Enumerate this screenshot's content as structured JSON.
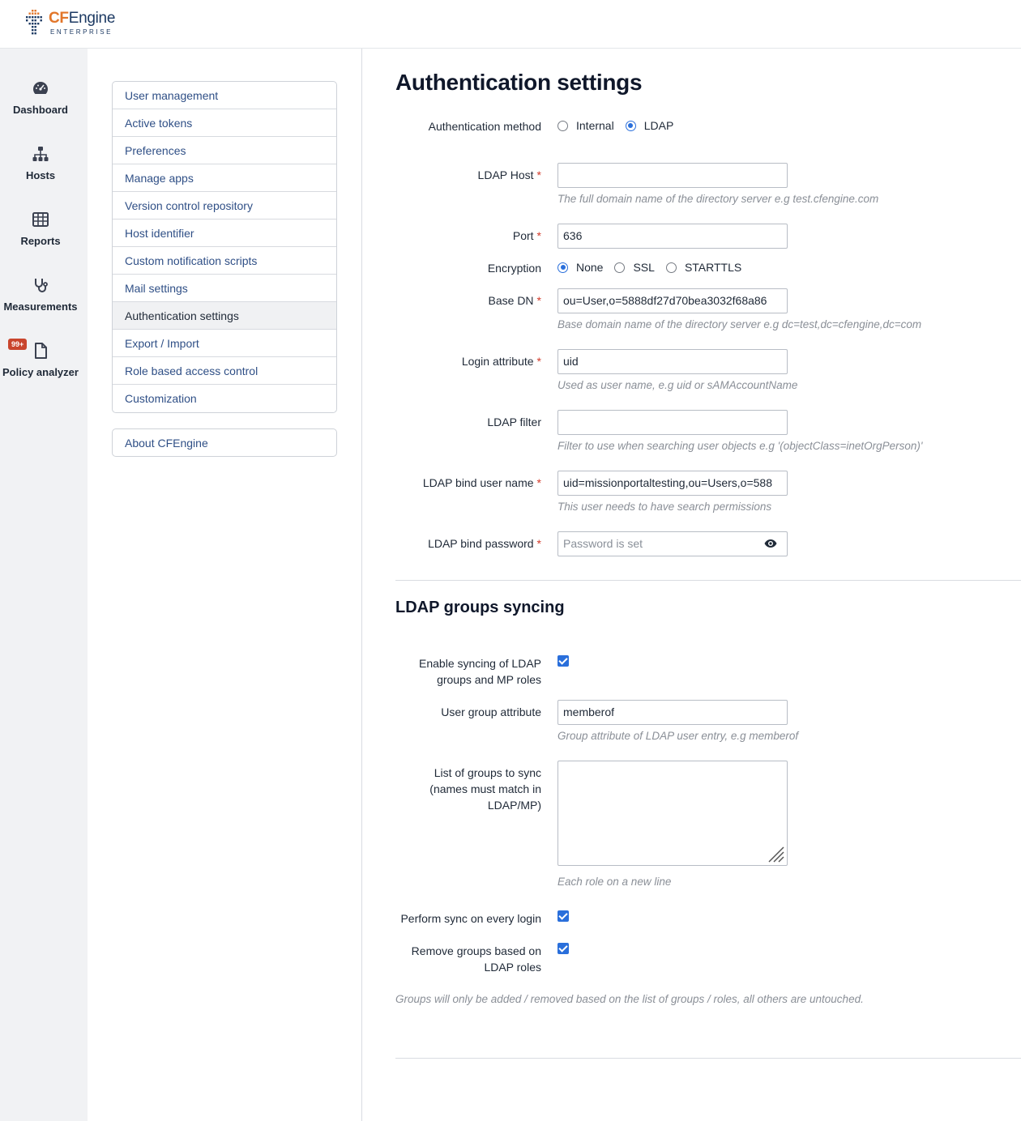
{
  "brand": {
    "cf": "CF",
    "engine": "Engine",
    "edition": "ENTERPRISE"
  },
  "nav": {
    "dashboard": "Dashboard",
    "hosts": "Hosts",
    "reports": "Reports",
    "measurements": "Measurements",
    "policy_analyzer": "Policy analyzer",
    "policy_badge": "99+"
  },
  "settings_menu": [
    "User management",
    "Active tokens",
    "Preferences",
    "Manage apps",
    "Version control repository",
    "Host identifier",
    "Custom notification scripts",
    "Mail settings",
    "Authentication settings",
    "Export / Import",
    "Role based access control",
    "Customization"
  ],
  "about": "About CFEngine",
  "page": {
    "title": "Authentication settings",
    "auth_method": {
      "label": "Authentication method",
      "internal": "Internal",
      "ldap": "LDAP",
      "selected": "LDAP"
    },
    "ldap_host": {
      "label": "LDAP Host",
      "value": "",
      "hint": "The full domain name of the directory server e.g test.cfengine.com"
    },
    "port": {
      "label": "Port",
      "value": "636"
    },
    "encryption": {
      "label": "Encryption",
      "none": "None",
      "ssl": "SSL",
      "starttls": "STARTTLS",
      "selected": "None"
    },
    "base_dn": {
      "label": "Base DN",
      "value": "ou=User,o=5888df27d70bea3032f68a86",
      "hint": "Base domain name of the directory server e.g dc=test,dc=cfengine,dc=com"
    },
    "login_attr": {
      "label": "Login attribute",
      "value": "uid",
      "hint": "Used as user name, e.g uid or sAMAccountName"
    },
    "ldap_filter": {
      "label": "LDAP filter",
      "value": "",
      "hint": "Filter to use when searching user objects e.g '(objectClass=inetOrgPerson)'"
    },
    "bind_user": {
      "label": "LDAP bind user name",
      "value": "uid=missionportaltesting,ou=Users,o=588",
      "hint": "This user needs to have search permissions"
    },
    "bind_password": {
      "label": "LDAP bind password",
      "placeholder": "Password is set"
    },
    "required_mark": "*"
  },
  "groups": {
    "title": "LDAP groups syncing",
    "enable_label_1": "Enable syncing of LDAP",
    "enable_label_2": "groups and MP roles",
    "enable_checked": true,
    "user_group_attr": {
      "label": "User group attribute",
      "value": "memberof",
      "hint": "Group attribute of LDAP user entry, e.g memberof"
    },
    "list_label_1": "List of groups to sync",
    "list_label_2": "(names must match in",
    "list_label_3": "LDAP/MP)",
    "list_hint": "Each role on a new line",
    "perform_sync_label": "Perform sync on every login",
    "perform_sync_checked": true,
    "remove_label_1": "Remove groups based on",
    "remove_label_2": "LDAP roles",
    "remove_checked": true,
    "footer_note": "Groups will only be added / removed based on the list of groups / roles, all others are untouched."
  }
}
